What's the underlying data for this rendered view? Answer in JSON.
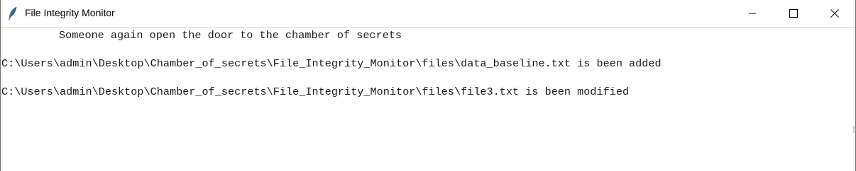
{
  "window": {
    "title": "File Integrity Monitor",
    "app_icon": "feather-icon",
    "controls": [
      "minimize-icon",
      "maximize-icon",
      "close-icon"
    ]
  },
  "log": {
    "lines": [
      "Someone again open the door to the chamber of secrets",
      "C:\\Users\\admin\\Desktop\\Chamber_of_secrets\\File_Integrity_Monitor\\files\\data_baseline.txt is been added",
      "C:\\Users\\admin\\Desktop\\Chamber_of_secrets\\File_Integrity_Monitor\\files\\file3.txt is been modified"
    ]
  }
}
